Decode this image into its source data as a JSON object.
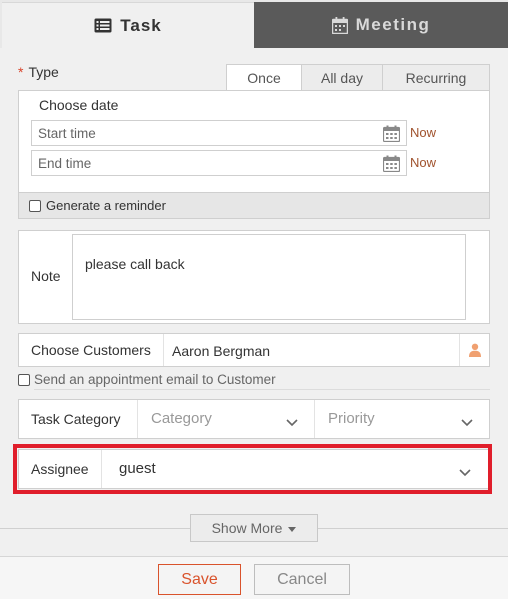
{
  "tabs": {
    "task": "Task",
    "meeting": "Meeting"
  },
  "type_section": {
    "required_mark": "*",
    "label": "Type",
    "sub_tabs": [
      "Once",
      "All day",
      "Recurring"
    ],
    "active_sub_tab": "Once",
    "choose_date": "Choose date",
    "start_time": {
      "placeholder": "Start time",
      "now_label": "Now"
    },
    "end_time": {
      "placeholder": "End time",
      "now_label": "Now"
    },
    "reminder": {
      "label": "Generate a reminder",
      "checked": false
    }
  },
  "note": {
    "label": "Note",
    "value": "please call back"
  },
  "customers": {
    "label": "Choose Customers",
    "value": "Aaron Bergman",
    "icon": "person-icon"
  },
  "email_option": {
    "label": "Send an appointment email to Customer",
    "checked": false
  },
  "task_category": {
    "label": "Task Category",
    "category_placeholder": "Category",
    "priority_placeholder": "Priority"
  },
  "assignee": {
    "label": "Assignee",
    "value": "guest"
  },
  "show_more": "Show More",
  "footer": {
    "save": "Save",
    "cancel": "Cancel"
  },
  "colors": {
    "accent": "#d9532c",
    "highlight": "#e01e2b",
    "meeting_tab_bg": "#5a5a5a",
    "now_link": "#a0522d"
  }
}
